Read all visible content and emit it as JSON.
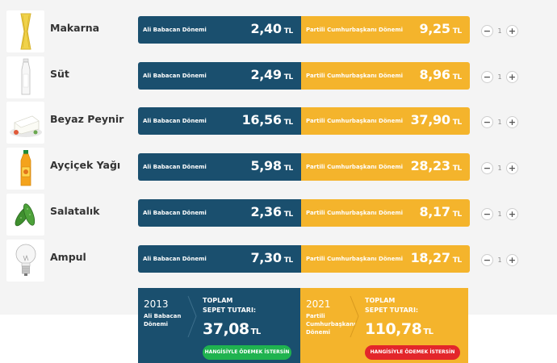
{
  "labels": {
    "left_period": "Ali Babacan Dönemi",
    "right_period": "Partili Cumhurbaşkanı Dönemi",
    "currency": "TL",
    "minus": "−",
    "plus": "+"
  },
  "products": [
    {
      "name": "Makarna",
      "old_price": "2,40",
      "new_price": "9,25",
      "qty": "1",
      "icon": "pasta-icon"
    },
    {
      "name": "Süt",
      "old_price": "2,49",
      "new_price": "8,96",
      "qty": "1",
      "icon": "milk-bottle-icon"
    },
    {
      "name": "Beyaz Peynir",
      "old_price": "16,56",
      "new_price": "37,90",
      "qty": "1",
      "icon": "cheese-icon"
    },
    {
      "name": "Ayçiçek Yağı",
      "old_price": "5,98",
      "new_price": "28,23",
      "qty": "1",
      "icon": "oil-bottle-icon"
    },
    {
      "name": "Salatalık",
      "old_price": "2,36",
      "new_price": "8,17",
      "qty": "1",
      "icon": "cucumber-icon"
    },
    {
      "name": "Ampul",
      "old_price": "7,30",
      "new_price": "18,27",
      "qty": "1",
      "icon": "lightbulb-icon"
    }
  ],
  "totals": {
    "left": {
      "year": "2013",
      "era_line1": "Ali Babacan",
      "era_line2": "Dönemi",
      "title1": "TOPLAM",
      "title2": "SEPET TUTARI:",
      "amount": "37,08",
      "button": "HANGİSİYLE ÖDEMEK İSTERSİN"
    },
    "right": {
      "year": "2021",
      "era_line1": "Partili",
      "era_line2": "Cumhurbaşkanı",
      "era_line3": "Dönemi",
      "title1": "TOPLAM",
      "title2": "SEPET TUTARI:",
      "amount": "110,78",
      "button": "HANGİSİYLE ÖDEMEK İSTERSİN"
    }
  },
  "colors": {
    "blue": "#1a4f6e",
    "yellow": "#f4b42c",
    "green": "#1fb34f",
    "red": "#e3262b"
  }
}
